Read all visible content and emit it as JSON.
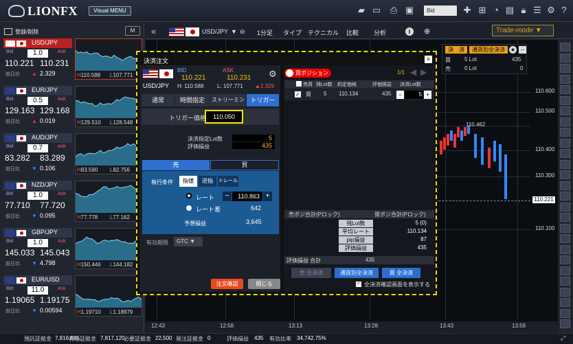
{
  "app": {
    "logo": "LIONFX",
    "mode_badge": "Visual MENU",
    "bid_select": "Bid"
  },
  "left": {
    "register_label": "登録/削除",
    "m_label": "M",
    "cards": [
      {
        "pair": "USD/JPY",
        "lot": "1.0",
        "bid": "110.221",
        "ask": "110.231",
        "change": "2.329",
        "dir": "up",
        "high": "110.588",
        "low": "107.771",
        "selected": true
      },
      {
        "pair": "EUR/JPY",
        "lot": "0.5",
        "bid": "129.163",
        "ask": "129.168",
        "change": "0.019",
        "dir": "up",
        "high": "129.510",
        "low": "128.548",
        "selected": false
      },
      {
        "pair": "AUD/JPY",
        "lot": "0.7",
        "bid": "83.282",
        "ask": "83.289",
        "change": "0.106",
        "dir": "down",
        "high": "83.590",
        "low": "82.756",
        "selected": false
      },
      {
        "pair": "NZD/JPY",
        "lot": "1.0",
        "bid": "77.710",
        "ask": "77.720",
        "change": "0.095",
        "dir": "down",
        "high": "77.778",
        "low": "77.162",
        "selected": false
      },
      {
        "pair": "GBP/JPY",
        "lot": "1.0",
        "bid": "145.033",
        "ask": "145.043",
        "change": "4.798",
        "dir": "down",
        "high": "150.446",
        "low": "144.182",
        "selected": false
      },
      {
        "pair": "EUR/USD",
        "lot": "11.0",
        "bid": "1.19065",
        "ask": "1.19175",
        "change": "0.00594",
        "dir": "down",
        "high": "1.19710",
        "low": "1.18979",
        "selected": false
      }
    ],
    "bid_label": "Bid",
    "ask_label": "Ask",
    "prev_label": "前日比"
  },
  "chart": {
    "pair": "USD/JPY",
    "interval": "1分足",
    "type": "タイプ",
    "technical": "テクニカル",
    "compare": "比較",
    "analysis": "分析",
    "trade_mode": "Trade-mode",
    "prices": [
      "110.600",
      "110.500",
      "110.462",
      "110.400",
      "110.300",
      "110.221",
      "110.100"
    ],
    "times": [
      "12:43",
      "12:58",
      "13:13",
      "13:28",
      "13:43",
      "13:58"
    ],
    "current": "110.221"
  },
  "posmini": {
    "sell_btn": "決　済",
    "close_btn": "通貨別全決済",
    "buy_label": "買",
    "buy_lot": "5 Lot",
    "buy_val": "435",
    "sell_label": "売",
    "sell_lot": "0 Lot",
    "sell_val": "0"
  },
  "dialog": {
    "title": "決済注文",
    "pair": "USD/JPY",
    "bid_label": "BID",
    "ask_label": "ASK",
    "bid": "110.221",
    "ask": "110.231",
    "high": "H: 110.588",
    "low": "L: 107.771",
    "change": "▲2.329",
    "tabs": [
      "通常",
      "時間指定",
      "ストリーミング",
      "トリガー"
    ],
    "trigger_label": "トリガー価格",
    "trigger_value": "110.050",
    "lot_label": "決済指定Lot数",
    "lot_value": "5",
    "pnl_label": "評価損益",
    "pnl_value": "435",
    "side_sell": "売",
    "side_buy": "買",
    "exec_label": "執行条件",
    "exec_opts": [
      "指値",
      "逆指",
      "トレール"
    ],
    "rate_label": "レート",
    "rate_value": "110.863",
    "rate_diff_label": "レート差",
    "rate_diff_value": "642",
    "expected_label": "予想損益",
    "expected_value": "3,645",
    "expiry_label": "有効期限",
    "expiry_value": "GTC",
    "confirm_btn": "注文確認",
    "close_btn": "閉じる"
  },
  "positions": {
    "toggle": "買ポジション",
    "page": "1/1",
    "headers": [
      "売買",
      "残Lot数",
      "約定価格",
      "評価損益",
      "決済Lot数"
    ],
    "row": {
      "side": "買",
      "lot": "5",
      "price": "110.134",
      "pnl": "435",
      "close_lot": "5"
    },
    "sell_total": "売ポジ合計(Pロック)",
    "buy_total": "買ポジ合計(Pロック)",
    "summary": [
      {
        "label": "残Lot数",
        "value": "5 (0)"
      },
      {
        "label": "平均レート",
        "value": "110.134"
      },
      {
        "label": "pip損益",
        "value": "87"
      },
      {
        "label": "評価損益",
        "value": "435"
      }
    ],
    "total_label": "評価損益 合計",
    "total_value": "435",
    "btn_sell_all": "売 全決済",
    "btn_pair_all": "通貨別全決済",
    "btn_buy_all": "買 全決済",
    "confirm_check": "全決済確認画面を表示する"
  },
  "status": {
    "items": [
      {
        "label": "預託証拠金",
        "value": "7,816,685"
      },
      {
        "label": "有効証拠金",
        "value": "7,817,120"
      },
      {
        "label": "必要証拠金",
        "value": "22,500"
      },
      {
        "label": "発注証拠金",
        "value": "0"
      },
      {
        "label": "評価損益",
        "value": "435"
      },
      {
        "label": "有効比率",
        "value": "34,742.75%"
      }
    ]
  }
}
